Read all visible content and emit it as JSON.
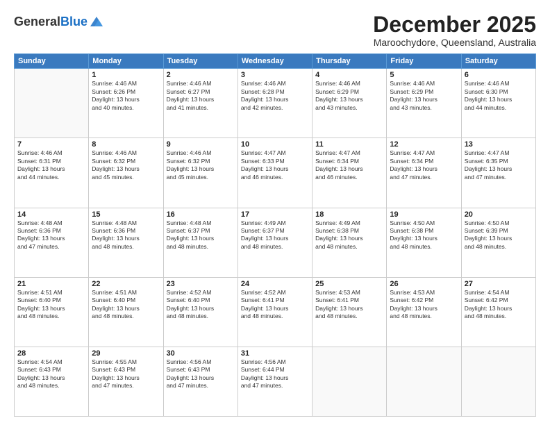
{
  "header": {
    "logo_general": "General",
    "logo_blue": "Blue",
    "month": "December 2025",
    "location": "Maroochydore, Queensland, Australia"
  },
  "weekdays": [
    "Sunday",
    "Monday",
    "Tuesday",
    "Wednesday",
    "Thursday",
    "Friday",
    "Saturday"
  ],
  "weeks": [
    [
      {
        "day": "",
        "info": ""
      },
      {
        "day": "1",
        "info": "Sunrise: 4:46 AM\nSunset: 6:26 PM\nDaylight: 13 hours\nand 40 minutes."
      },
      {
        "day": "2",
        "info": "Sunrise: 4:46 AM\nSunset: 6:27 PM\nDaylight: 13 hours\nand 41 minutes."
      },
      {
        "day": "3",
        "info": "Sunrise: 4:46 AM\nSunset: 6:28 PM\nDaylight: 13 hours\nand 42 minutes."
      },
      {
        "day": "4",
        "info": "Sunrise: 4:46 AM\nSunset: 6:29 PM\nDaylight: 13 hours\nand 43 minutes."
      },
      {
        "day": "5",
        "info": "Sunrise: 4:46 AM\nSunset: 6:29 PM\nDaylight: 13 hours\nand 43 minutes."
      },
      {
        "day": "6",
        "info": "Sunrise: 4:46 AM\nSunset: 6:30 PM\nDaylight: 13 hours\nand 44 minutes."
      }
    ],
    [
      {
        "day": "7",
        "info": "Sunrise: 4:46 AM\nSunset: 6:31 PM\nDaylight: 13 hours\nand 44 minutes."
      },
      {
        "day": "8",
        "info": "Sunrise: 4:46 AM\nSunset: 6:32 PM\nDaylight: 13 hours\nand 45 minutes."
      },
      {
        "day": "9",
        "info": "Sunrise: 4:46 AM\nSunset: 6:32 PM\nDaylight: 13 hours\nand 45 minutes."
      },
      {
        "day": "10",
        "info": "Sunrise: 4:47 AM\nSunset: 6:33 PM\nDaylight: 13 hours\nand 46 minutes."
      },
      {
        "day": "11",
        "info": "Sunrise: 4:47 AM\nSunset: 6:34 PM\nDaylight: 13 hours\nand 46 minutes."
      },
      {
        "day": "12",
        "info": "Sunrise: 4:47 AM\nSunset: 6:34 PM\nDaylight: 13 hours\nand 47 minutes."
      },
      {
        "day": "13",
        "info": "Sunrise: 4:47 AM\nSunset: 6:35 PM\nDaylight: 13 hours\nand 47 minutes."
      }
    ],
    [
      {
        "day": "14",
        "info": "Sunrise: 4:48 AM\nSunset: 6:36 PM\nDaylight: 13 hours\nand 47 minutes."
      },
      {
        "day": "15",
        "info": "Sunrise: 4:48 AM\nSunset: 6:36 PM\nDaylight: 13 hours\nand 48 minutes."
      },
      {
        "day": "16",
        "info": "Sunrise: 4:48 AM\nSunset: 6:37 PM\nDaylight: 13 hours\nand 48 minutes."
      },
      {
        "day": "17",
        "info": "Sunrise: 4:49 AM\nSunset: 6:37 PM\nDaylight: 13 hours\nand 48 minutes."
      },
      {
        "day": "18",
        "info": "Sunrise: 4:49 AM\nSunset: 6:38 PM\nDaylight: 13 hours\nand 48 minutes."
      },
      {
        "day": "19",
        "info": "Sunrise: 4:50 AM\nSunset: 6:38 PM\nDaylight: 13 hours\nand 48 minutes."
      },
      {
        "day": "20",
        "info": "Sunrise: 4:50 AM\nSunset: 6:39 PM\nDaylight: 13 hours\nand 48 minutes."
      }
    ],
    [
      {
        "day": "21",
        "info": "Sunrise: 4:51 AM\nSunset: 6:40 PM\nDaylight: 13 hours\nand 48 minutes."
      },
      {
        "day": "22",
        "info": "Sunrise: 4:51 AM\nSunset: 6:40 PM\nDaylight: 13 hours\nand 48 minutes."
      },
      {
        "day": "23",
        "info": "Sunrise: 4:52 AM\nSunset: 6:40 PM\nDaylight: 13 hours\nand 48 minutes."
      },
      {
        "day": "24",
        "info": "Sunrise: 4:52 AM\nSunset: 6:41 PM\nDaylight: 13 hours\nand 48 minutes."
      },
      {
        "day": "25",
        "info": "Sunrise: 4:53 AM\nSunset: 6:41 PM\nDaylight: 13 hours\nand 48 minutes."
      },
      {
        "day": "26",
        "info": "Sunrise: 4:53 AM\nSunset: 6:42 PM\nDaylight: 13 hours\nand 48 minutes."
      },
      {
        "day": "27",
        "info": "Sunrise: 4:54 AM\nSunset: 6:42 PM\nDaylight: 13 hours\nand 48 minutes."
      }
    ],
    [
      {
        "day": "28",
        "info": "Sunrise: 4:54 AM\nSunset: 6:43 PM\nDaylight: 13 hours\nand 48 minutes."
      },
      {
        "day": "29",
        "info": "Sunrise: 4:55 AM\nSunset: 6:43 PM\nDaylight: 13 hours\nand 47 minutes."
      },
      {
        "day": "30",
        "info": "Sunrise: 4:56 AM\nSunset: 6:43 PM\nDaylight: 13 hours\nand 47 minutes."
      },
      {
        "day": "31",
        "info": "Sunrise: 4:56 AM\nSunset: 6:44 PM\nDaylight: 13 hours\nand 47 minutes."
      },
      {
        "day": "",
        "info": ""
      },
      {
        "day": "",
        "info": ""
      },
      {
        "day": "",
        "info": ""
      }
    ]
  ]
}
